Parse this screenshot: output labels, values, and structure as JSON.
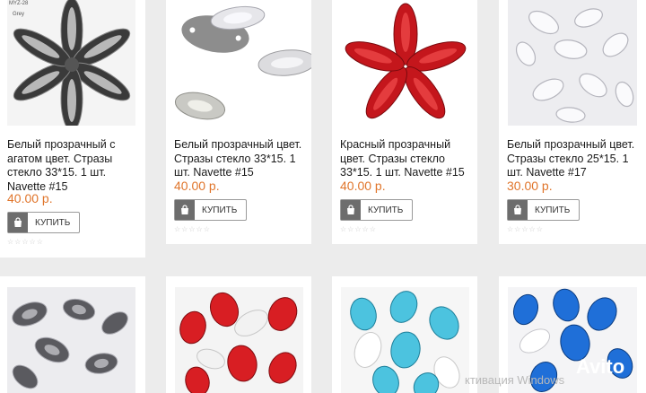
{
  "products": [
    {
      "title": "Белый прозрачный с агатом цвет. Стразы стекло 33*15. 1 шт. Navette #15",
      "price": "40.00 р.",
      "button": "КУПИТЬ",
      "rating": "☆☆☆☆☆",
      "tag_top": "MYZ-28",
      "tag_bottom": "Grey"
    },
    {
      "title": "Белый прозрачный цвет. Стразы стекло 33*15. 1 шт. Navette #15",
      "price": "40.00 р.",
      "button": "КУПИТЬ",
      "rating": "☆☆☆☆☆"
    },
    {
      "title": "Красный прозрачный цвет. Стразы стекло 33*15. 1 шт. Navette #15",
      "price": "40.00 р.",
      "button": "КУПИТЬ",
      "rating": "☆☆☆☆☆"
    },
    {
      "title": "Белый прозрачный цвет. Стразы стекло 25*15. 1 шт. Navette #17",
      "price": "30.00 р.",
      "button": "КУПИТЬ",
      "rating": "☆☆☆☆☆"
    }
  ],
  "second_row_images": [
    "grey-crystal-drops",
    "red-crystal-drops",
    "aqua-crystal-drops",
    "blue-crystal-drops"
  ],
  "overlay": {
    "watermark": "ктивация Windows",
    "logo": "Avito"
  },
  "colors": {
    "price": "#e0752b",
    "button_icon_bg": "#6d6d6d",
    "page_bg": "#ececec"
  }
}
